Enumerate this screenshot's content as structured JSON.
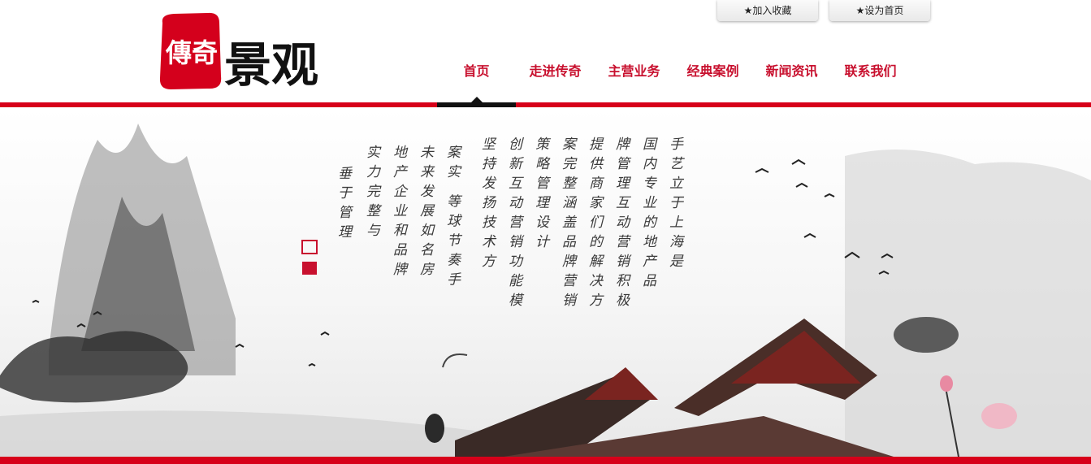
{
  "header": {
    "logo": {
      "seal_text": "傳奇",
      "wordmark": "景观"
    },
    "top_buttons": [
      {
        "label": "★加入收藏"
      },
      {
        "label": "★设为首页"
      }
    ],
    "nav": [
      {
        "label": "首页",
        "active": true
      },
      {
        "label": "走进传奇"
      },
      {
        "label": "主营业务"
      },
      {
        "label": "经典案例"
      },
      {
        "label": "新闻资讯"
      },
      {
        "label": "联系我们"
      }
    ]
  },
  "banner": {
    "poem_columns": [
      "手艺立于上海是",
      "国内专业的地产品",
      "牌管理互动营销积极",
      "提供商家们的解决方",
      "案完整涵盖品牌营销",
      "策略管理设计",
      "创新互动营销功能模",
      "坚持发扬技术方",
      "案实 等球节奏手",
      "未来发展如名房",
      "地产企业和品牌",
      "实力完整与",
      "垂于管理"
    ]
  },
  "colors": {
    "brand_red": "#d7001a",
    "nav_red": "#c8102e",
    "active_tab": "#111111"
  },
  "icons": [
    "star-icon",
    "seal-logo",
    "ink-landscape",
    "ink-birds",
    "pavilion-roof",
    "lotus-flower",
    "seal-stamp"
  ]
}
